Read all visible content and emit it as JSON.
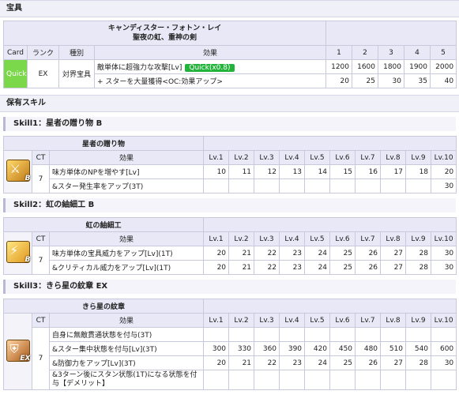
{
  "noble_phantasm": {
    "section_title": "宝具",
    "name": "キャンディスター・フォトン・レイ",
    "ruby": "聖夜の虹、重神の剣",
    "headers": [
      "Card",
      "ランク",
      "種別",
      "効果",
      "1",
      "2",
      "3",
      "4",
      "5"
    ],
    "card": "Quick",
    "rank": "EX",
    "type": "対界宝具",
    "effects": [
      {
        "text": "敵単体に超強力な攻撃[Lv]",
        "badge": "Quick(x0.8)",
        "values": [
          "1200",
          "1600",
          "1800",
          "1900",
          "2000"
        ]
      },
      {
        "text": "+ スターを大量獲得<OC:効果アップ>",
        "badge": "",
        "values": [
          "20",
          "25",
          "30",
          "35",
          "40"
        ]
      }
    ]
  },
  "skills_section_title": "保有スキル",
  "level_headers": [
    "Lv.1",
    "Lv.2",
    "Lv.3",
    "Lv.4",
    "Lv.5",
    "Lv.6",
    "Lv.7",
    "Lv.8",
    "Lv.9",
    "Lv.10"
  ],
  "skills": [
    {
      "header": "Skill1：星者の贈り物 B",
      "name": "星者の贈り物",
      "icon": "sword-buff-icon",
      "rank": "B",
      "ct": "7",
      "ct_label": "CT",
      "effect_label": "効果",
      "rows": [
        {
          "text": "味方単体のNPを増やす[Lv]",
          "values": [
            "10",
            "11",
            "12",
            "13",
            "14",
            "15",
            "16",
            "17",
            "18",
            "20"
          ]
        },
        {
          "text": "&スター発生率をアップ(3T)",
          "values": [
            "",
            "",
            "",
            "",
            "",
            "",
            "",
            "",
            "",
            "30"
          ]
        }
      ]
    },
    {
      "header": "Skill2：虹の紬細工 B",
      "name": "虹の紬細工",
      "icon": "lightning-buff-icon",
      "rank": "B",
      "ct": "7",
      "ct_label": "CT",
      "effect_label": "効果",
      "rows": [
        {
          "text": "味方単体の宝具威力をアップ[Lv](1T)",
          "values": [
            "20",
            "21",
            "22",
            "23",
            "24",
            "25",
            "26",
            "27",
            "28",
            "30"
          ]
        },
        {
          "text": "&クリティカル威力をアップ[Lv](1T)",
          "values": [
            "20",
            "21",
            "22",
            "23",
            "24",
            "25",
            "26",
            "27",
            "28",
            "30"
          ]
        }
      ]
    },
    {
      "header": "Skill3：きら星の紋章 EX",
      "name": "きら星の紋章",
      "icon": "shield-buff-icon",
      "rank": "EX",
      "ct": "7",
      "ct_label": "CT",
      "effect_label": "効果",
      "rows": [
        {
          "text": "自身に無敵貫通状態を付与(3T)",
          "values": [
            "",
            "",
            "",
            "",
            "",
            "",
            "",
            "",
            "",
            ""
          ]
        },
        {
          "text": "&スター集中状態を付与[Lv](3T)",
          "values": [
            "300",
            "330",
            "360",
            "390",
            "420",
            "450",
            "480",
            "510",
            "540",
            "600"
          ]
        },
        {
          "text": "&防御力をアップ[Lv](3T)",
          "values": [
            "20",
            "21",
            "22",
            "23",
            "24",
            "25",
            "26",
            "27",
            "28",
            "30"
          ]
        },
        {
          "text": "&3ターン後にスタン状態(1T)になる状態を付与【デメリット】",
          "values": [
            "",
            "",
            "",
            "",
            "",
            "",
            "",
            "",
            "",
            ""
          ]
        }
      ]
    }
  ]
}
